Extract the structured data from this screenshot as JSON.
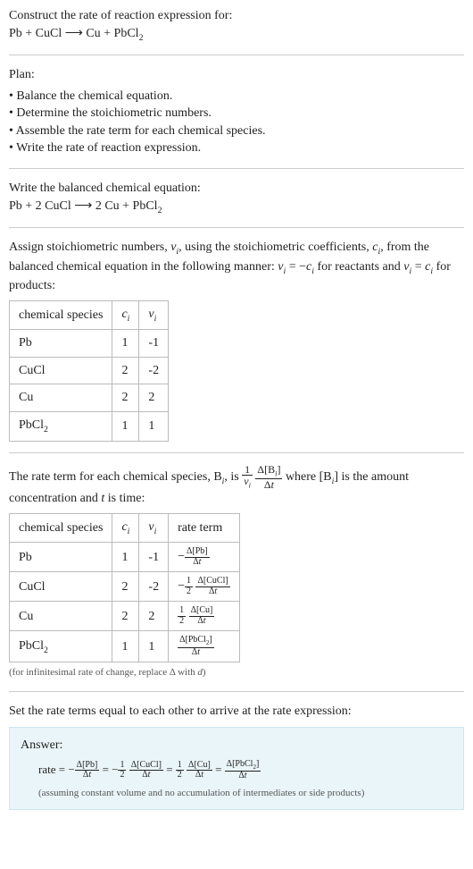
{
  "intro": {
    "prompt": "Construct the rate of reaction expression for:",
    "equation_html": "Pb + CuCl ⟶ Cu + PbCl<sub class='sub'>2</sub>"
  },
  "plan": {
    "heading": "Plan:",
    "items": [
      "Balance the chemical equation.",
      "Determine the stoichiometric numbers.",
      "Assemble the rate term for each chemical species.",
      "Write the rate of reaction expression."
    ]
  },
  "balanced": {
    "heading": "Write the balanced chemical equation:",
    "equation_html": "Pb + 2 CuCl ⟶ 2 Cu + PbCl<sub class='sub'>2</sub>"
  },
  "stoich": {
    "intro_html": "Assign stoichiometric numbers, <span class='italic'>ν<sub class='sub'>i</sub></span>, using the stoichiometric coefficients, <span class='italic'>c<sub class='sub'>i</sub></span>, from the balanced chemical equation in the following manner: <span class='italic'>ν<sub class='sub'>i</sub></span> = −<span class='italic'>c<sub class='sub'>i</sub></span> for reactants and <span class='italic'>ν<sub class='sub'>i</sub></span> = <span class='italic'>c<sub class='sub'>i</sub></span> for products:",
    "headers": {
      "species": "chemical species",
      "ci": "c_i",
      "vi": "ν_i"
    },
    "rows": [
      {
        "species_html": "Pb",
        "ci": "1",
        "vi": "-1"
      },
      {
        "species_html": "CuCl",
        "ci": "2",
        "vi": "-2"
      },
      {
        "species_html": "Cu",
        "ci": "2",
        "vi": "2"
      },
      {
        "species_html": "PbCl<sub class='sub'>2</sub>",
        "ci": "1",
        "vi": "1"
      }
    ]
  },
  "rate_terms": {
    "intro_pre": "The rate term for each chemical species, B",
    "intro_mid": ", is ",
    "intro_post_html": " where [B<sub class='sub'><span class='italic'>i</span></sub>] is the amount concentration and <span class='italic'>t</span> is time:",
    "headers": {
      "species": "chemical species",
      "ci": "c_i",
      "vi": "ν_i",
      "rate": "rate term"
    },
    "rows": [
      {
        "species_html": "Pb",
        "ci": "1",
        "vi": "-1",
        "rate_html": "−<span class='smallfrac'><span class='num'>Δ[Pb]</span><span class='den'>Δ<span class='italic'>t</span></span></span>"
      },
      {
        "species_html": "CuCl",
        "ci": "2",
        "vi": "-2",
        "rate_html": "−<span class='smallfrac'><span class='num'>1</span><span class='den'>2</span></span> <span class='smallfrac'><span class='num'>Δ[CuCl]</span><span class='den'>Δ<span class='italic'>t</span></span></span>"
      },
      {
        "species_html": "Cu",
        "ci": "2",
        "vi": "2",
        "rate_html": "<span class='smallfrac'><span class='num'>1</span><span class='den'>2</span></span> <span class='smallfrac'><span class='num'>Δ[Cu]</span><span class='den'>Δ<span class='italic'>t</span></span></span>"
      },
      {
        "species_html": "PbCl<sub class='sub'>2</sub>",
        "ci": "1",
        "vi": "1",
        "rate_html": "<span class='smallfrac'><span class='num'>Δ[PbCl<sub class='sub'>2</sub>]</span><span class='den'>Δ<span class='italic'>t</span></span></span>"
      }
    ],
    "note_html": "(for infinitesimal rate of change, replace Δ with <span class='italic'>d</span>)"
  },
  "final": {
    "heading": "Set the rate terms equal to each other to arrive at the rate expression:",
    "answer_label": "Answer:",
    "rate_html": "rate = −<span class='smallfrac'><span class='num'>Δ[Pb]</span><span class='den'>Δ<span class='italic'>t</span></span></span> = −<span class='smallfrac'><span class='num'>1</span><span class='den'>2</span></span> <span class='smallfrac'><span class='num'>Δ[CuCl]</span><span class='den'>Δ<span class='italic'>t</span></span></span> = <span class='smallfrac'><span class='num'>1</span><span class='den'>2</span></span> <span class='smallfrac'><span class='num'>Δ[Cu]</span><span class='den'>Δ<span class='italic'>t</span></span></span> = <span class='smallfrac'><span class='num'>Δ[PbCl<sub class='sub'>2</sub>]</span><span class='den'>Δ<span class='italic'>t</span></span></span>",
    "sub_note": "(assuming constant volume and no accumulation of intermediates or side products)"
  }
}
